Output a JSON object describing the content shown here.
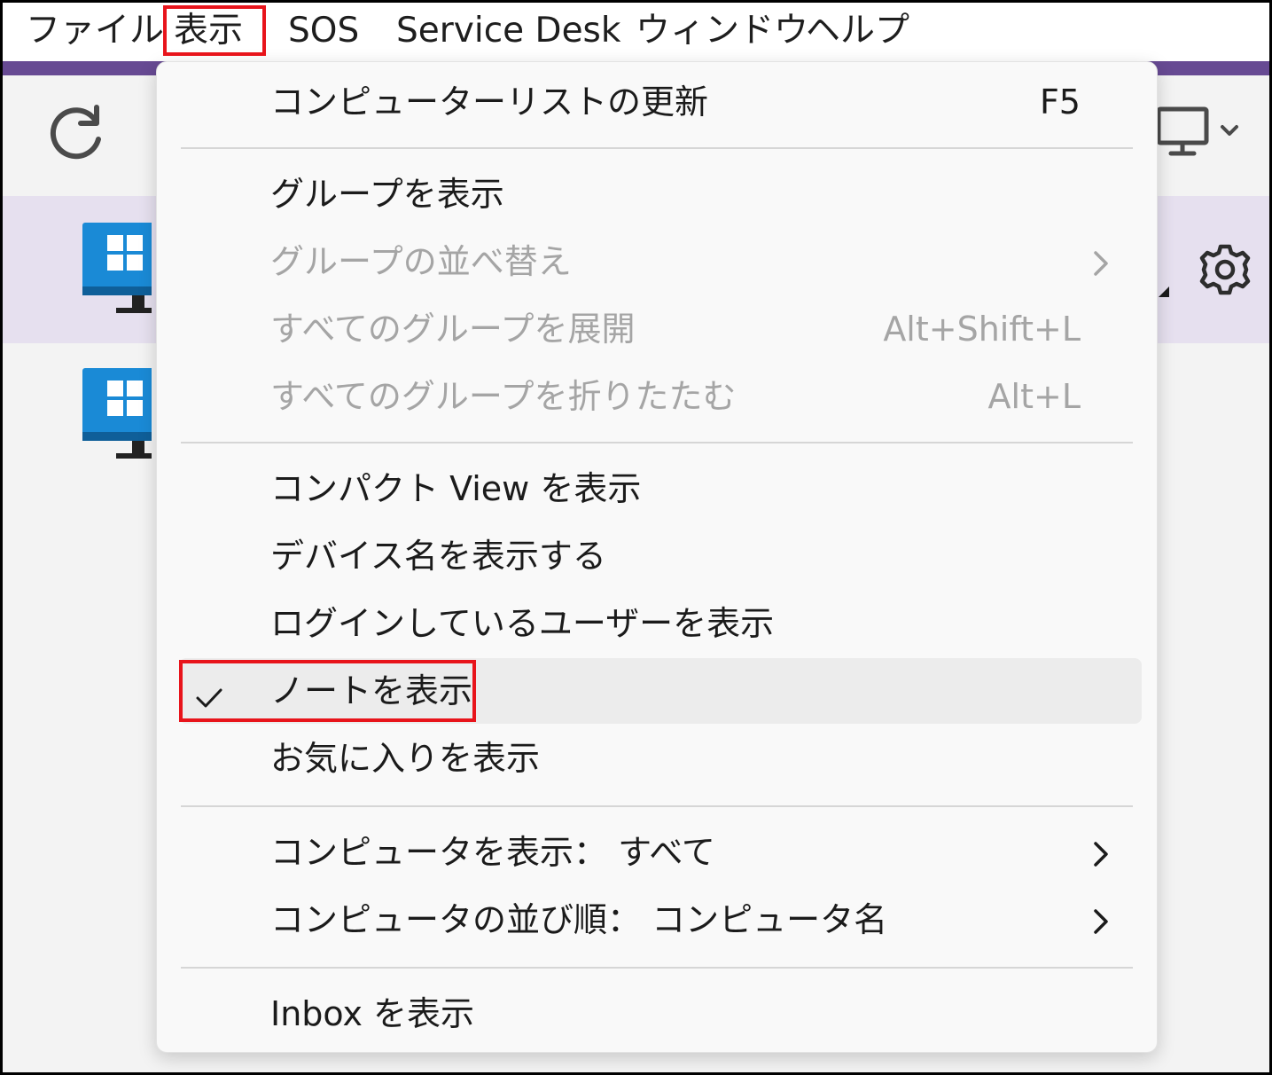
{
  "menubar": {
    "items": [
      {
        "label": "ファイル"
      },
      {
        "label": "表示"
      },
      {
        "label": "SOS"
      },
      {
        "label": "Service Desk"
      },
      {
        "label": "ウィンドウ"
      },
      {
        "label": "ヘルプ"
      }
    ]
  },
  "view_menu": {
    "items": [
      {
        "label": "コンピューターリストの更新",
        "shortcut": "F5",
        "enabled": true
      },
      {
        "label": "グループを表示",
        "enabled": true
      },
      {
        "label": "グループの並べ替え",
        "enabled": false,
        "has_submenu": true
      },
      {
        "label": "すべてのグループを展開",
        "shortcut": "Alt+Shift+L",
        "enabled": false
      },
      {
        "label": "すべてのグループを折りたたむ",
        "shortcut": "Alt+L",
        "enabled": false
      },
      {
        "label": "コンパクト View を表示",
        "enabled": true
      },
      {
        "label": "デバイス名を表示する",
        "enabled": true
      },
      {
        "label": "ログインしているユーザーを表示",
        "enabled": true
      },
      {
        "label": "ノートを表示",
        "enabled": true,
        "checked": true
      },
      {
        "label": "お気に入りを表示",
        "enabled": true
      },
      {
        "label": "コンピュータを表示： すべて",
        "enabled": true,
        "has_submenu": true
      },
      {
        "label": "コンピュータの並び順： コンピュータ名",
        "enabled": true,
        "has_submenu": true
      },
      {
        "label": "Inbox を表示",
        "enabled": true
      }
    ]
  },
  "icons": {
    "refresh": "refresh-icon",
    "display": "monitor-icon",
    "dropdown": "chevron-down-icon",
    "settings": "gear-icon",
    "computer": "windows-computer-icon",
    "check": "checkmark-icon",
    "submenu": "chevron-right-icon"
  },
  "colors": {
    "accent": "#674a93",
    "selected_row": "#e6e0ef",
    "highlight": "#e8141b",
    "disabled_text": "#a5a5a5",
    "computer_blue": "#1a8ad6"
  }
}
